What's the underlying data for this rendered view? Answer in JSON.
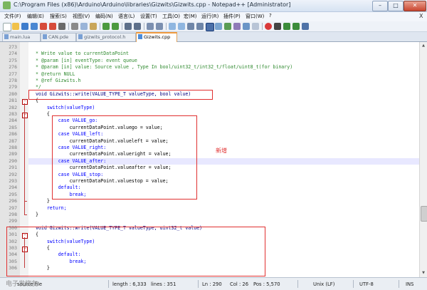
{
  "window": {
    "title": "C:\\Program Files (x86)\\Arduino\\Arduino\\libraries\\Gizwits\\Gizwits.cpp - Notepad++ [Administrator]",
    "minimize": "–",
    "maximize": "□",
    "close": "✕"
  },
  "menu": {
    "items": [
      "文件(F)",
      "编辑(E)",
      "搜索(S)",
      "视图(V)",
      "编码(N)",
      "语言(L)",
      "设置(T)",
      "工具(O)",
      "宏(M)",
      "运行(R)",
      "插件(P)",
      "窗口(W)",
      "?"
    ],
    "close": "X"
  },
  "tabs": [
    "main.lua",
    "CAN.pde",
    "gizwits_protocol.h",
    "Gizwits.cpp"
  ],
  "code_lines": [
    {
      "n": "273",
      "t": ""
    },
    {
      "n": "274",
      "t": "  * Write value to currentDataPoint"
    },
    {
      "n": "275",
      "t": "  * @param [in] eventType: event queue"
    },
    {
      "n": "276",
      "t": "  * @param [in] value: Source value , Type In bool/uint32_t/int32_t/float/uint8_t(for binary)"
    },
    {
      "n": "277",
      "t": "  * @return NULL"
    },
    {
      "n": "278",
      "t": "  * @ref Gizwits.h"
    },
    {
      "n": "279",
      "t": "  */"
    },
    {
      "n": "280",
      "t": "  void Gizwits::write(VALUE_TYPE_T valueType, bool value)"
    },
    {
      "n": "281",
      "t": "  {"
    },
    {
      "n": "282",
      "t": "      switch(valueType)"
    },
    {
      "n": "283",
      "t": "      {"
    },
    {
      "n": "284",
      "t": "          case VALUE_go:"
    },
    {
      "n": "285",
      "t": "              currentDataPoint.valuego = value;"
    },
    {
      "n": "286",
      "t": "          case VALUE_left:"
    },
    {
      "n": "287",
      "t": "              currentDataPoint.valueleft = value;"
    },
    {
      "n": "288",
      "t": "          case VALUE_right:"
    },
    {
      "n": "289",
      "t": "              currentDataPoint.valueright = value;"
    },
    {
      "n": "290",
      "t": "          case VALUE_after:"
    },
    {
      "n": "291",
      "t": "              currentDataPoint.valueafter = value;"
    },
    {
      "n": "292",
      "t": "          case VALUE_stop:"
    },
    {
      "n": "293",
      "t": "              currentDataPoint.valuestop = value;"
    },
    {
      "n": "294",
      "t": "          default:"
    },
    {
      "n": "295",
      "t": "              break;"
    },
    {
      "n": "296",
      "t": "      }"
    },
    {
      "n": "297",
      "t": "      return;"
    },
    {
      "n": "298",
      "t": "  }"
    },
    {
      "n": "299",
      "t": ""
    },
    {
      "n": "300",
      "t": "  void Gizwits::write(VALUE_TYPE_T valueType, uint32_t value)"
    },
    {
      "n": "301",
      "t": "  {"
    },
    {
      "n": "302",
      "t": "      switch(valueType)"
    },
    {
      "n": "303",
      "t": "      {"
    },
    {
      "n": "304",
      "t": "          default:"
    },
    {
      "n": "305",
      "t": "              break;"
    },
    {
      "n": "306",
      "t": "      }"
    }
  ],
  "annotation": {
    "label": "新增"
  },
  "status": {
    "file_type": "source file",
    "length": "length : 6,333",
    "lines": "lines : 351",
    "ln": "Ln : 290",
    "col": "Col : 26",
    "pos": "Pos : 5,570",
    "eol": "Unix (LF)",
    "encoding": "UTF-8",
    "mode": "INS"
  },
  "watermark": "电子发烧友",
  "colors": {
    "annotation": "#e03030",
    "comment": "#2f8a2f",
    "keyword": "#0000ff",
    "type": "#8a00b8"
  }
}
